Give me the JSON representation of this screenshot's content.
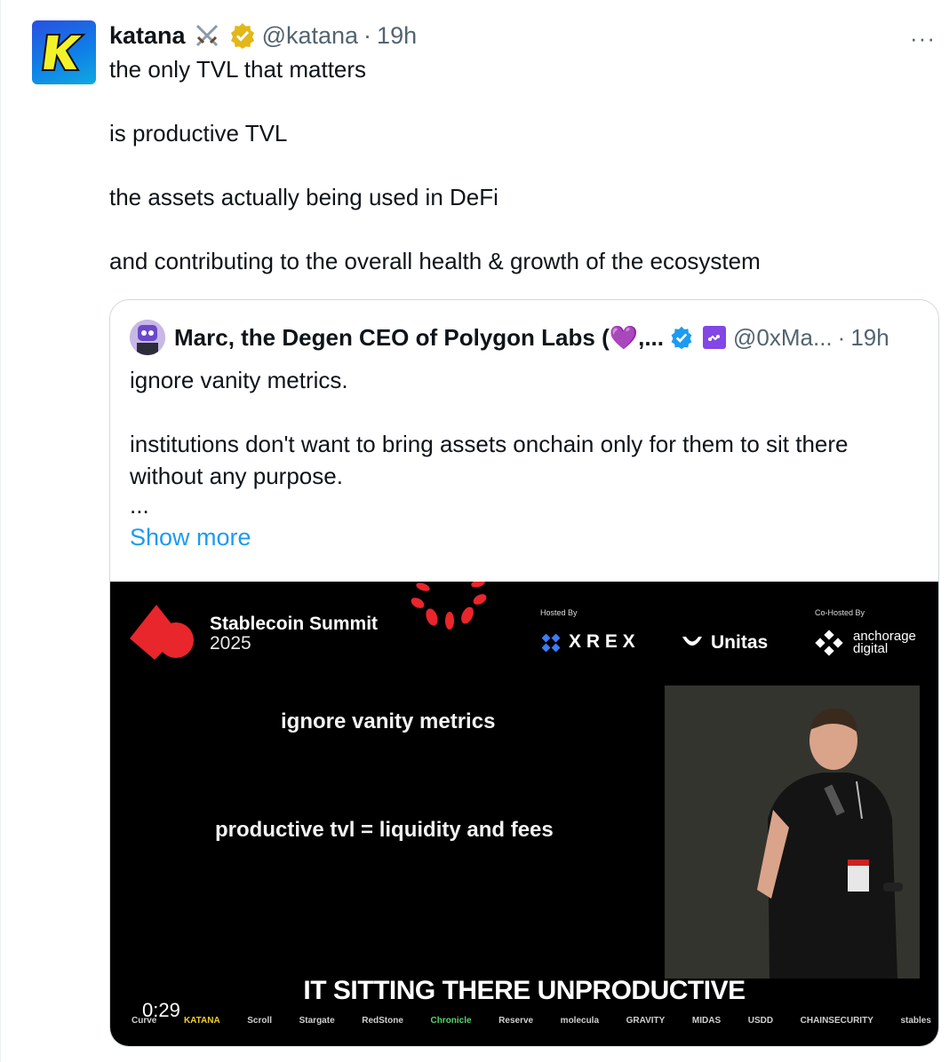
{
  "tweet": {
    "name": "katana",
    "handle": "@katana",
    "separator": "·",
    "time": "19h",
    "more": "···",
    "paragraphs": [
      "the only TVL that matters",
      "is productive TVL",
      "the assets actually being used in DeFi",
      "and contributing to the overall health & growth of the ecosystem"
    ]
  },
  "quote": {
    "name": "Marc, the Degen CEO of Polygon Labs (💜,...",
    "handle": "@0xMa...",
    "separator": "·",
    "time": "19h",
    "paragraphs": [
      "ignore vanity metrics.",
      "institutions don't want to bring assets onchain only for them to sit there without any purpose."
    ],
    "ellipsis": "...",
    "show_more": "Show more"
  },
  "video": {
    "event_title": "Stablecoin Summit",
    "event_year": "2025",
    "hosted_by": "Hosted By",
    "co_hosted_by": "Co-Hosted By",
    "sponsor_xrex": "X R E X",
    "sponsor_unitas": "Unitas",
    "sponsor_anchorage_1": "anchorage",
    "sponsor_anchorage_2": "digital",
    "slide_line_1": "ignore vanity metrics",
    "slide_line_2": "productive tvl = liquidity and fees",
    "caption": "IT SITTING THERE UNPRODUCTIVE",
    "timestamp": "0:29",
    "footer_logos": [
      "Curve",
      "KATANA",
      "Scroll",
      "Stargate",
      "RedStone",
      "Chronicle",
      "Reserve",
      "molecula",
      "GRAVITY",
      "MIDAS",
      "USDD",
      "CHAINSECURITY",
      "stables"
    ]
  },
  "colors": {
    "link": "#1d9bf0",
    "verified_blue": "#1d9bf0",
    "verified_gold": "#e2b719",
    "secondary_text": "#536471",
    "polygon_purple": "#8247e5",
    "summit_red": "#e8262b"
  },
  "icons": {
    "verified_gold": "verified-gold-badge-icon",
    "verified_blue": "verified-blue-badge-icon",
    "affiliate": "polygon-affiliate-icon",
    "swords": "crossed-swords-emoji-icon"
  }
}
